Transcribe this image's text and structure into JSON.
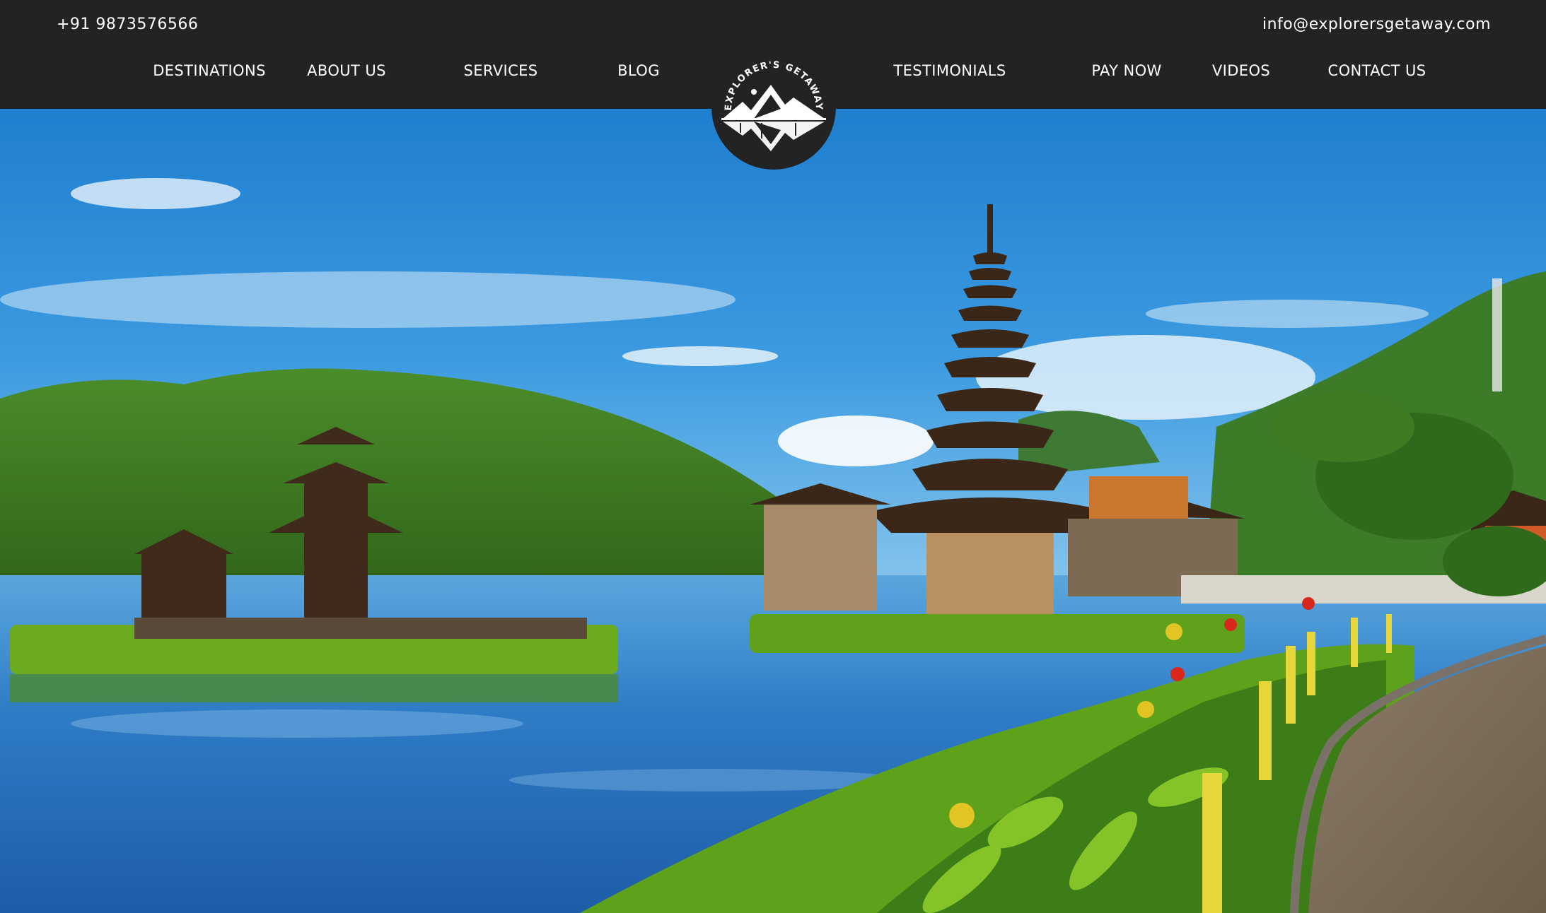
{
  "topbar": {
    "phone": "+91 9873576566",
    "email": "info@explorersgetaway.com"
  },
  "nav": {
    "destinations": "DESTINATIONS",
    "about": "ABOUT US",
    "services": "SERVICES",
    "blog": "BLOG",
    "testimonials": "TESTIMONIALS",
    "pay_now": "PAY NOW",
    "videos": "VIDEOS",
    "contact": "CONTACT US"
  },
  "logo": {
    "text": "EXPLORER'S GETAWAY",
    "icon": "mountain-reflection-icon"
  },
  "hero": {
    "image": "bali-lake-temple-photo"
  },
  "colors": {
    "header_bg": "#232323",
    "nav_text": "#ffffff",
    "sky": "#2a8fd6",
    "water": "#2f78c4",
    "foliage": "#3e7d1e"
  }
}
